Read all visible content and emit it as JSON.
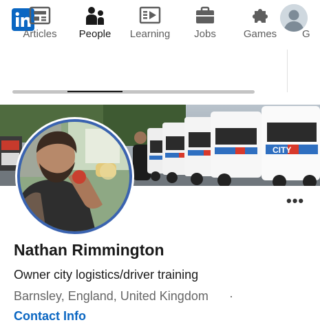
{
  "app": {
    "logo_text": "in",
    "brand_color": "#0a66c2"
  },
  "nav": {
    "items": [
      {
        "label": "Articles",
        "icon": "articles-icon"
      },
      {
        "label": "People",
        "icon": "people-icon",
        "active": true
      },
      {
        "label": "Learning",
        "icon": "learning-icon"
      },
      {
        "label": "Jobs",
        "icon": "briefcase-icon"
      },
      {
        "label": "Games",
        "icon": "puzzle-icon"
      },
      {
        "label": "G",
        "icon": ""
      }
    ]
  },
  "profile": {
    "name": "Nathan Rimmington",
    "headline": "Owner city logistics/driver training",
    "location": "Barnsley, England, United Kingdom",
    "separator": "·",
    "contact_label": "Contact Info",
    "more_label": "•••",
    "banner_truck_text": "CITY"
  },
  "colors": {
    "link": "#0a66c2",
    "photo_ring": "#3a63b0",
    "text_primary": "#191919",
    "text_secondary": "#666666"
  }
}
